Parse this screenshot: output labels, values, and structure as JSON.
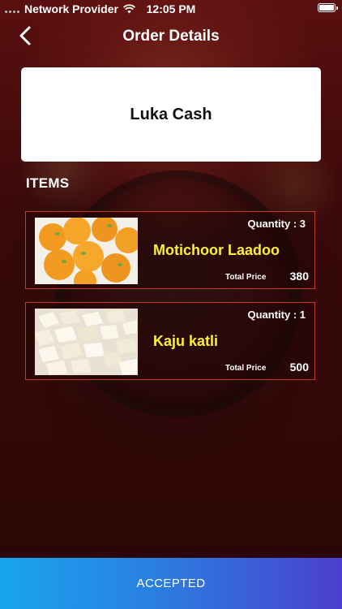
{
  "status_bar": {
    "carrier": "Network Provider",
    "time": "12:05 PM",
    "icons": [
      "signal-dots-icon",
      "wifi-icon",
      "battery-icon"
    ]
  },
  "nav": {
    "title": "Order Details",
    "back_icon": "chevron-left-icon"
  },
  "customer": {
    "name": "Luka Cash"
  },
  "items_heading": "ITEMS",
  "items": [
    {
      "name": "Motichoor Laadoo",
      "quantity_text": "Quantity : 3",
      "total_label": "Total Price",
      "total_value": "380",
      "image": "laddoo-photo"
    },
    {
      "name": "Kaju katli",
      "quantity_text": "Quantity : 1",
      "total_label": "Total Price",
      "total_value": "500",
      "image": "kaju-katli-photo"
    }
  ],
  "action": {
    "label": "ACCEPTED"
  },
  "colors": {
    "item_name": "#ffef3a",
    "item_border": "#c0392b",
    "button_gradient_start": "#18a5ee",
    "button_gradient_end": "#4b3fcf"
  }
}
